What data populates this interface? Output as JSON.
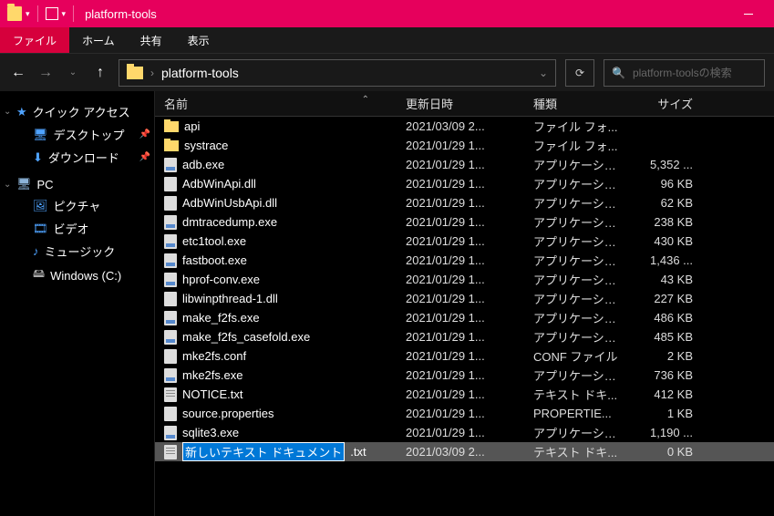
{
  "window": {
    "title": "platform-tools"
  },
  "ribbon": {
    "file": "ファイル",
    "home": "ホーム",
    "share": "共有",
    "view": "表示"
  },
  "address": {
    "crumb": "platform-tools"
  },
  "search": {
    "placeholder": "platform-toolsの検索"
  },
  "sidebar": {
    "quick_access": "クイック アクセス",
    "desktop": "デスクトップ",
    "downloads": "ダウンロード",
    "pc": "PC",
    "pictures": "ピクチャ",
    "videos": "ビデオ",
    "music": "ミュージック",
    "drive_c": "Windows (C:)"
  },
  "columns": {
    "name": "名前",
    "date": "更新日時",
    "type": "種類",
    "size": "サイズ"
  },
  "files": [
    {
      "icon": "folder",
      "name": "api",
      "date": "2021/03/09 2...",
      "type": "ファイル フォ...",
      "size": ""
    },
    {
      "icon": "folder",
      "name": "systrace",
      "date": "2021/01/29 1...",
      "type": "ファイル フォ...",
      "size": ""
    },
    {
      "icon": "exe",
      "name": "adb.exe",
      "date": "2021/01/29 1...",
      "type": "アプリケーショ...",
      "size": "5,352 ..."
    },
    {
      "icon": "dll",
      "name": "AdbWinApi.dll",
      "date": "2021/01/29 1...",
      "type": "アプリケーショ...",
      "size": "96 KB"
    },
    {
      "icon": "dll",
      "name": "AdbWinUsbApi.dll",
      "date": "2021/01/29 1...",
      "type": "アプリケーショ...",
      "size": "62 KB"
    },
    {
      "icon": "exe",
      "name": "dmtracedump.exe",
      "date": "2021/01/29 1...",
      "type": "アプリケーショ...",
      "size": "238 KB"
    },
    {
      "icon": "exe",
      "name": "etc1tool.exe",
      "date": "2021/01/29 1...",
      "type": "アプリケーショ...",
      "size": "430 KB"
    },
    {
      "icon": "exe",
      "name": "fastboot.exe",
      "date": "2021/01/29 1...",
      "type": "アプリケーショ...",
      "size": "1,436 ..."
    },
    {
      "icon": "exe",
      "name": "hprof-conv.exe",
      "date": "2021/01/29 1...",
      "type": "アプリケーショ...",
      "size": "43 KB"
    },
    {
      "icon": "dll",
      "name": "libwinpthread-1.dll",
      "date": "2021/01/29 1...",
      "type": "アプリケーショ...",
      "size": "227 KB"
    },
    {
      "icon": "exe",
      "name": "make_f2fs.exe",
      "date": "2021/01/29 1...",
      "type": "アプリケーショ...",
      "size": "486 KB"
    },
    {
      "icon": "exe",
      "name": "make_f2fs_casefold.exe",
      "date": "2021/01/29 1...",
      "type": "アプリケーショ...",
      "size": "485 KB"
    },
    {
      "icon": "conf",
      "name": "mke2fs.conf",
      "date": "2021/01/29 1...",
      "type": "CONF ファイル",
      "size": "2 KB"
    },
    {
      "icon": "exe",
      "name": "mke2fs.exe",
      "date": "2021/01/29 1...",
      "type": "アプリケーショ...",
      "size": "736 KB"
    },
    {
      "icon": "txt",
      "name": "NOTICE.txt",
      "date": "2021/01/29 1...",
      "type": "テキスト ドキ...",
      "size": "412 KB"
    },
    {
      "icon": "prop",
      "name": "source.properties",
      "date": "2021/01/29 1...",
      "type": "PROPERTIE...",
      "size": "1 KB"
    },
    {
      "icon": "exe",
      "name": "sqlite3.exe",
      "date": "2021/01/29 1...",
      "type": "アプリケーショ...",
      "size": "1,190 ..."
    }
  ],
  "editing_row": {
    "selected_text": "新しいテキスト ドキュメント",
    "ext": ".txt",
    "date": "2021/03/09 2...",
    "type": "テキスト ドキ...",
    "size": "0 KB"
  }
}
